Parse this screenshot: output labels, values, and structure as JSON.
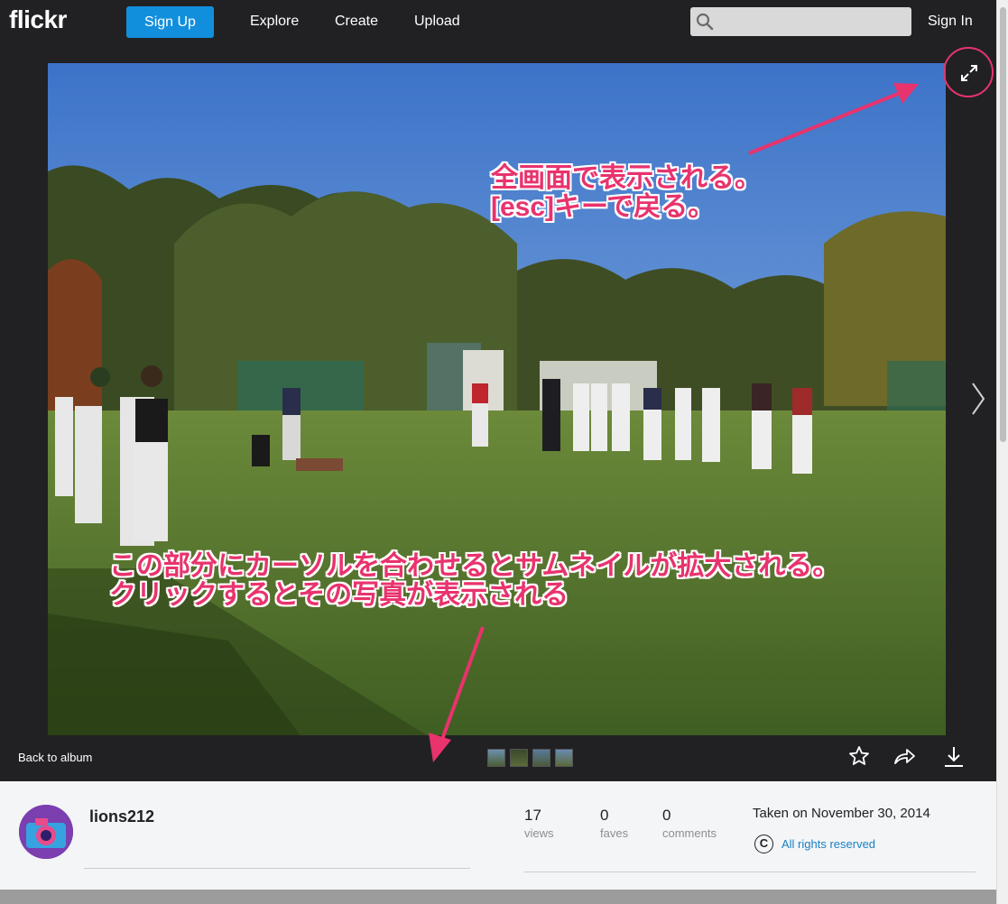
{
  "nav": {
    "logo": "flickr",
    "signup": "Sign Up",
    "links": [
      "Explore",
      "Create",
      "Upload"
    ],
    "search_placeholder": "",
    "signin": "Sign In"
  },
  "annotations": {
    "note1_line1": "全画面で表示される。",
    "note1_line2": "[esc]キーで戻る。",
    "note2_line1": "この部分にカーソルを合わせるとサムネイルが拡大される。",
    "note2_line2": "クリックするとその写真が表示される"
  },
  "photobar": {
    "back": "Back to album",
    "thumbnails": 4
  },
  "info": {
    "username": "lions212",
    "views": "17",
    "views_label": "views",
    "faves": "0",
    "faves_label": "faves",
    "comments": "0",
    "comments_label": "comments",
    "taken": "Taken on November 30, 2014",
    "copyright_symbol": "C",
    "rights": "All rights reserved"
  },
  "colors": {
    "accent": "#128fdc",
    "annotation": "#e8336d",
    "link": "#1a80c4"
  }
}
